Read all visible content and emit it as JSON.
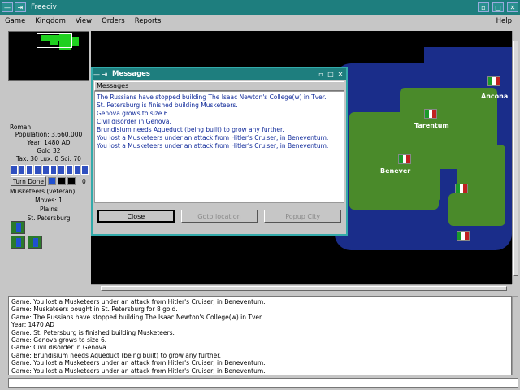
{
  "window": {
    "title": "Freeciv"
  },
  "menu": {
    "game": "Game",
    "kingdom": "Kingdom",
    "view": "View",
    "orders": "Orders",
    "reports": "Reports",
    "help": "Help"
  },
  "info": {
    "nation": "Roman",
    "population": "Population: 3,660,000",
    "year": "Year: 1480 AD",
    "gold": "Gold 32",
    "tax": "Tax: 30 Lux: 0 Sci: 70",
    "turn_done": "Turn Done",
    "turn_number": "0"
  },
  "unit": {
    "name": "Musketeers (veteran)",
    "moves": "Moves: 1",
    "terrain": "Plains",
    "city": "St. Petersburg"
  },
  "map": {
    "cities": [
      "Ancona",
      "Tarentum",
      "Benever"
    ]
  },
  "dialog": {
    "title": "Messages",
    "list_header": "Messages",
    "messages": [
      "The Russians have stopped building The Isaac Newton's College(w) in Tver.",
      "St. Petersburg is finished building Musketeers.",
      "Genova grows to size 6.",
      "Civil disorder in Genova.",
      "Brundisium needs Aqueduct (being built) to grow any further.",
      "You lost a Musketeers under an attack from Hitler's Cruiser, in Beneventum.",
      "You lost a Musketeers under an attack from Hitler's Cruiser, in Beneventum."
    ],
    "close": "Close",
    "goto": "Goto location",
    "popup": "Popup City"
  },
  "log": [
    "Game: You lost a Musketeers under an attack from Hitler's Cruiser, in Beneventum.",
    "Game: Musketeers bought in St. Petersburg for 8 gold.",
    "Game: The Russians have stopped building The Isaac Newton's College(w) in Tver.",
    "Year: 1470 AD",
    "Game: St. Petersburg is finished building Musketeers.",
    "Game: Genova grows to size 6.",
    "Game: Civil disorder in Genova.",
    "Game: Brundisium needs Aqueduct (being built) to grow any further.",
    "Game: You lost a Musketeers under an attack from Hitler's Cruiser, in Beneventum.",
    "Game: You lost a Musketeers under an attack from Hitler's Cruiser, in Beneventum."
  ]
}
